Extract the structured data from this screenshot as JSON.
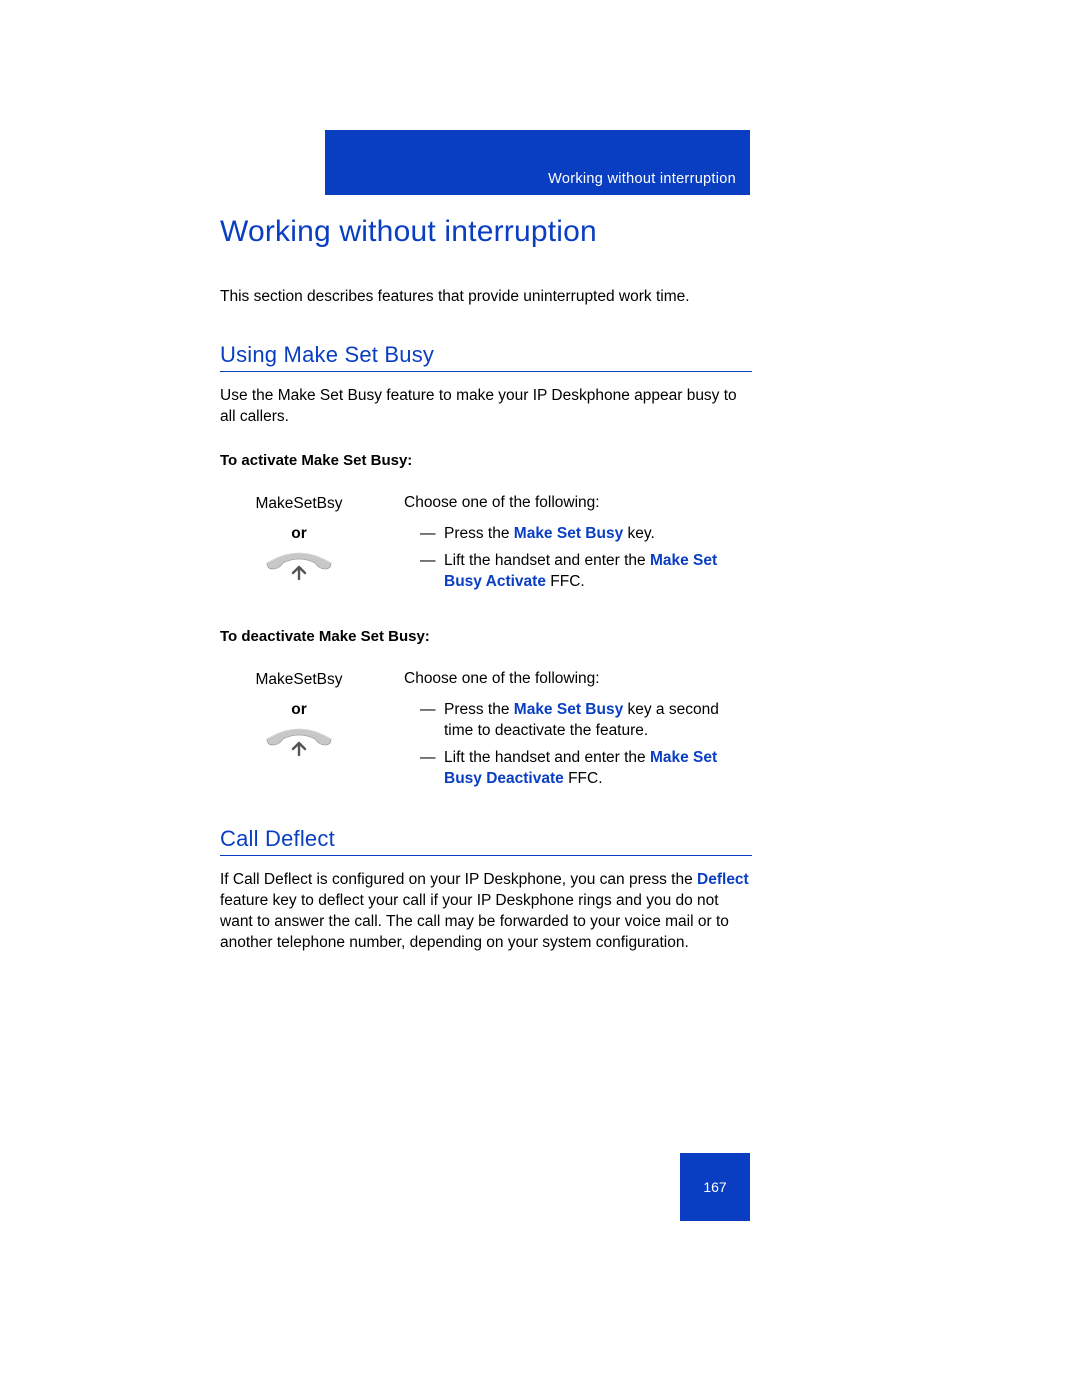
{
  "header": {
    "running_title": "Working without interruption"
  },
  "title": "Working without interruption",
  "intro": "This section describes features that provide uninterrupted work time.",
  "sections": {
    "make_set_busy": {
      "heading": "Using Make Set Busy",
      "intro": "Use the Make Set Busy feature to make your IP Deskphone appear busy to all callers.",
      "activate": {
        "title": "To activate Make Set Busy:",
        "key_label": "MakeSetBsy",
        "or": "or",
        "lead": "Choose one of the following:",
        "b1_pre": "Press the ",
        "b1_kw": "Make Set Busy",
        "b1_post": " key.",
        "b2_pre": "Lift the handset and enter the ",
        "b2_kw": "Make Set Busy Activate",
        "b2_post": " FFC."
      },
      "deactivate": {
        "title": "To deactivate Make Set Busy:",
        "key_label": "MakeSetBsy",
        "or": "or",
        "lead": "Choose one of the following:",
        "b1_pre": "Press the ",
        "b1_kw": "Make Set Busy",
        "b1_post": " key a second time to deactivate the feature.",
        "b2_pre": "Lift the handset and enter the ",
        "b2_kw": "Make Set Busy Deactivate",
        "b2_post": " FFC."
      }
    },
    "call_deflect": {
      "heading": "Call Deflect",
      "p_pre": "If Call Deflect is configured on your IP Deskphone, you can press the ",
      "p_kw": "Deflect",
      "p_post": " feature key to deflect your call if your IP Deskphone rings and you do not want to answer the call. The call may be forwarded to your voice mail or to another telephone number, depending on your system configuration."
    }
  },
  "page_number": "167",
  "icons": {
    "handset": "lift-handset-icon"
  }
}
